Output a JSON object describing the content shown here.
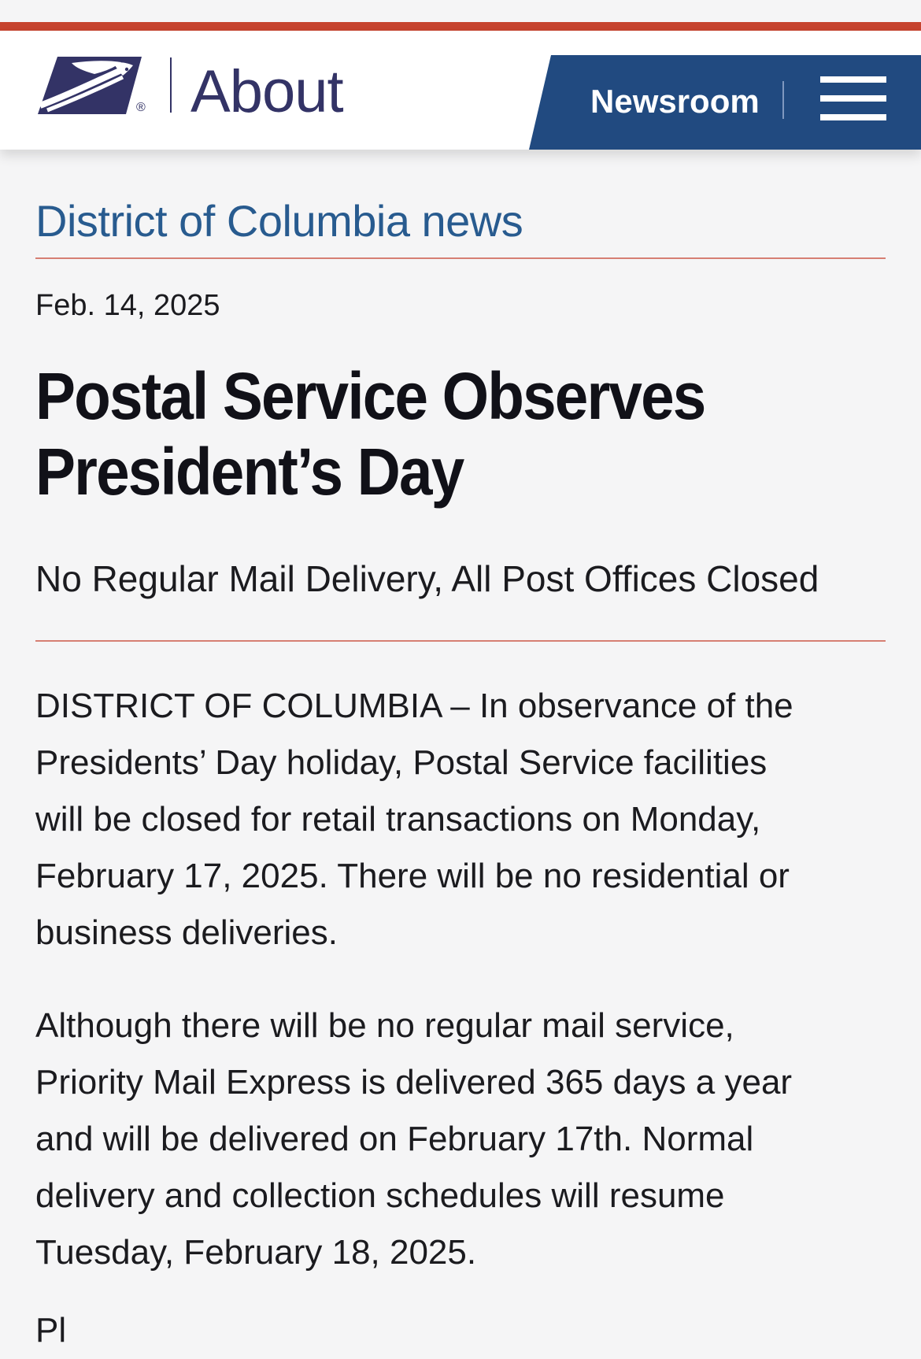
{
  "colors": {
    "accent_red": "#c6432e",
    "usps_navy": "#333366",
    "newsroom_blue": "#214a80",
    "section_link_blue": "#285b8f",
    "rule_pink": "#d67f73",
    "page_background": "#f5f5f6"
  },
  "header": {
    "logo_icon": "usps-eagle-logo",
    "registered_mark": "®",
    "section_name": "About",
    "newsroom_label": "Newsroom",
    "menu_icon": "hamburger-menu-icon"
  },
  "article": {
    "section_title": "District of Columbia news",
    "date": "Feb. 14, 2025",
    "headline_line1": "Postal Service Observes",
    "headline_line2": "President’s Day",
    "subhead": "No Regular Mail Delivery, All Post Offices Closed",
    "paragraph1_lines": [
      "DISTRICT OF COLUMBIA – In observance of the",
      "Presidents’ Day holiday, Postal Service facilities",
      "will be closed for retail transactions on Monday,",
      "February 17, 2025. There will be no residential or",
      "business deliveries."
    ],
    "paragraph2_lines": [
      "Although there will be no regular mail service,",
      "Priority Mail Express is delivered 365 days a year",
      "and will be delivered on February 17th. Normal",
      "delivery and collection schedules will resume",
      "Tuesday, February 18, 2025."
    ],
    "cut_off_line": "Pl"
  }
}
